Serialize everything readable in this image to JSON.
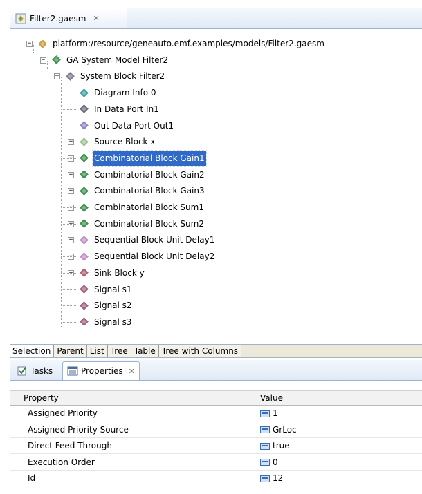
{
  "editor": {
    "tab_label": "Filter2.gaesm",
    "tab_close": "✕",
    "tab_icon": "model-file-icon"
  },
  "tree": {
    "nodes": [
      {
        "label": "platform:/resource/geneauto.emf.examples/models/Filter2.gaesm",
        "icon": "model-file-icon",
        "expander": "−",
        "color": "#c8a040"
      },
      {
        "label": "GA System Model Filter2",
        "icon": "green-diamond-icon",
        "expander": "−",
        "color": "#3f8f4f"
      },
      {
        "label": "System Block Filter2",
        "icon": "grey-diamond-icon",
        "expander": "−",
        "color": "#7b7b8f"
      },
      {
        "label": "Diagram Info 0",
        "icon": "teal-diamond-icon",
        "expander": "",
        "color": "#3aa0a0"
      },
      {
        "label": "In Data Port In1",
        "icon": "grey-diamond-icon",
        "expander": "",
        "color": "#6a6a7a"
      },
      {
        "label": "Out Data Port Out1",
        "icon": "lavender-diamond-icon",
        "expander": "",
        "color": "#8c88c8"
      },
      {
        "label": "Source Block x",
        "icon": "lightgreen-diamond-icon",
        "expander": "+",
        "color": "#9ac48a"
      },
      {
        "label": "Combinatorial Block Gain1",
        "icon": "green-diamond-icon",
        "expander": "+",
        "color": "#3f8f4f",
        "selected": true
      },
      {
        "label": "Combinatorial Block Gain2",
        "icon": "green-diamond-icon",
        "expander": "+",
        "color": "#3f8f4f"
      },
      {
        "label": "Combinatorial Block Gain3",
        "icon": "green-diamond-icon",
        "expander": "+",
        "color": "#3f8f4f"
      },
      {
        "label": "Combinatorial Block Sum1",
        "icon": "green-diamond-icon",
        "expander": "+",
        "color": "#3f8f4f"
      },
      {
        "label": "Combinatorial Block Sum2",
        "icon": "green-diamond-icon",
        "expander": "+",
        "color": "#3f8f4f"
      },
      {
        "label": "Sequential Block Unit Delay1",
        "icon": "pink-diamond-icon",
        "expander": "+",
        "color": "#c090c8"
      },
      {
        "label": "Sequential Block Unit Delay2",
        "icon": "pink-diamond-icon",
        "expander": "+",
        "color": "#c090c8"
      },
      {
        "label": "Sink Block y",
        "icon": "rose-diamond-icon",
        "expander": "+",
        "color": "#b06070"
      },
      {
        "label": "Signal s1",
        "icon": "rose-diamond-icon",
        "expander": "",
        "color": "#a06080"
      },
      {
        "label": "Signal s2",
        "icon": "rose-diamond-icon",
        "expander": "",
        "color": "#a06080"
      },
      {
        "label": "Signal s3",
        "icon": "rose-diamond-icon",
        "expander": "",
        "color": "#a06080"
      }
    ]
  },
  "bottom_tabs": [
    "Selection",
    "Parent",
    "List",
    "Tree",
    "Table",
    "Tree with Columns"
  ],
  "views": {
    "tasks_label": "Tasks",
    "properties_label": "Properties",
    "close": "✕"
  },
  "properties": {
    "col_property": "Property",
    "col_value": "Value",
    "rows": [
      {
        "name": "Assigned Priority",
        "value": "1",
        "icon": "integer-value-icon"
      },
      {
        "name": "Assigned Priority Source",
        "value": "GrLoc",
        "icon": "enum-value-icon"
      },
      {
        "name": "Direct Feed Through",
        "value": "true",
        "icon": "boolean-value-icon"
      },
      {
        "name": "Execution Order",
        "value": "0",
        "icon": "integer-value-icon"
      },
      {
        "name": "Id",
        "value": "12",
        "icon": "integer-value-icon"
      }
    ]
  },
  "colors": {
    "selection": "#316ac5",
    "tab_border": "#9fb3cc"
  }
}
